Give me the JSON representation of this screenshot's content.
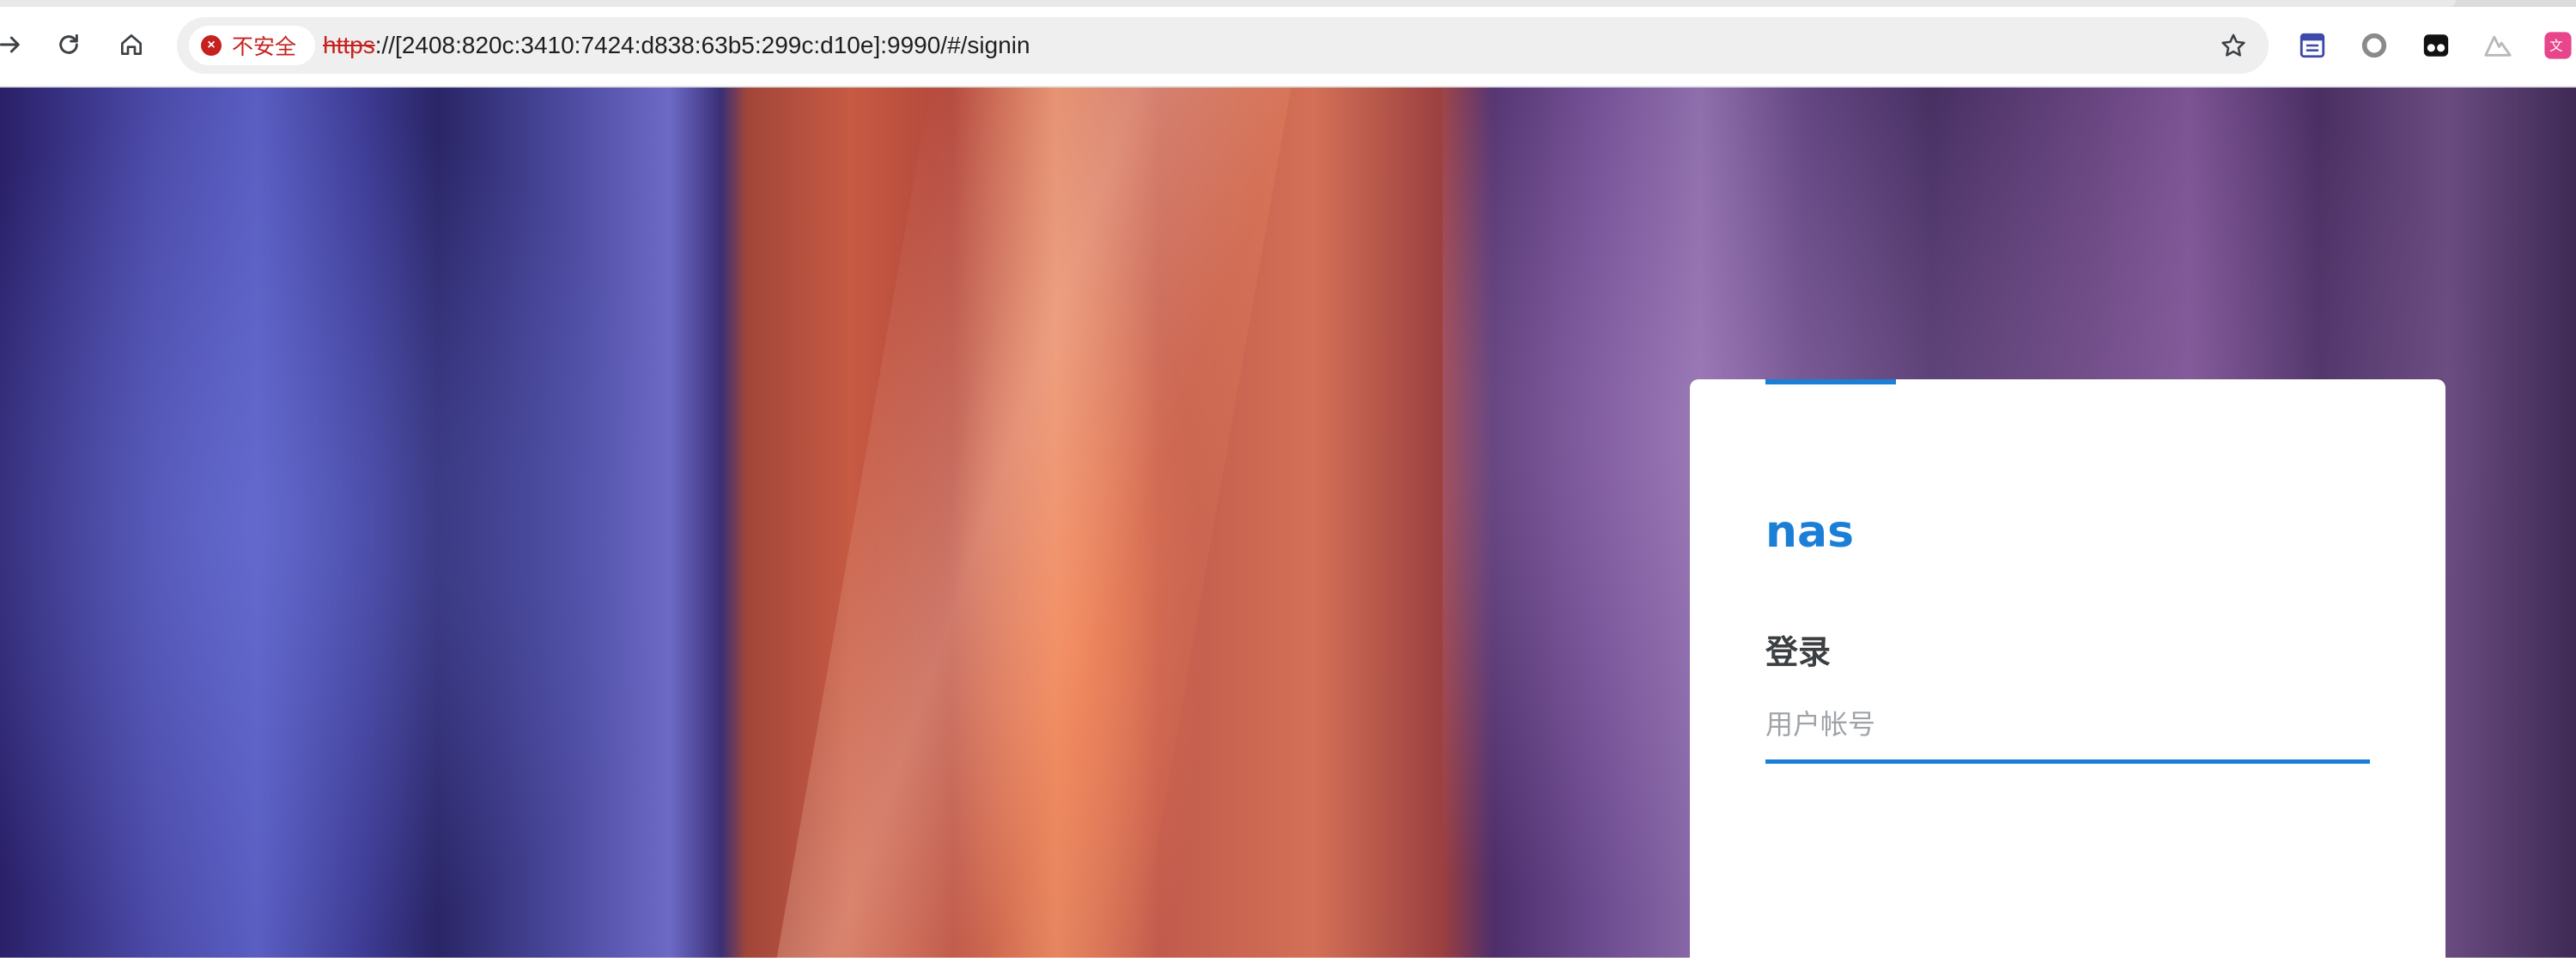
{
  "browser": {
    "security_label": "不安全",
    "url_scheme": "https",
    "url_rest": "://[2408:820c:3410:7424:d838:63b5:299c:d10e]:9990/#/signin",
    "nav_icons": [
      "forward-icon",
      "reload-icon",
      "home-icon"
    ],
    "extension_icons": [
      "reader-mode-icon",
      "extension-ring-icon",
      "extension-glasses-icon",
      "extension-mountain-icon",
      "translate-icon"
    ]
  },
  "login": {
    "app_name": "nas",
    "title": "登录",
    "username_placeholder": "用户帐号"
  },
  "colors": {
    "accent": "#1b7fd6",
    "insecure": "#c5221f",
    "title_text": "#3c4043"
  }
}
